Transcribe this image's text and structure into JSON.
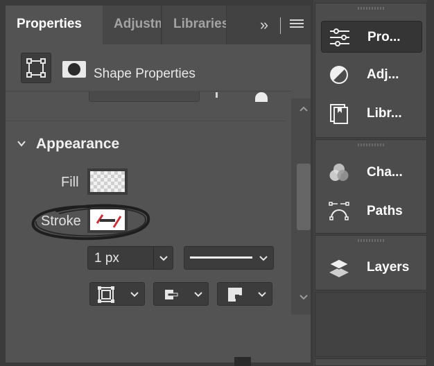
{
  "tabs": [
    {
      "label": "Properties",
      "active": true
    },
    {
      "label": "Adjustm",
      "active": false
    },
    {
      "label": "Libraries",
      "active": false
    }
  ],
  "tab_collapse_label": "»",
  "shape_header": {
    "title": "Shape Properties"
  },
  "appearance": {
    "title": "Appearance",
    "fill_label": "Fill",
    "stroke_label": "Stroke",
    "stroke_width": "1 px"
  },
  "dock": {
    "items": [
      {
        "label": "Pro...",
        "icon": "sliders-icon"
      },
      {
        "label": "Adj...",
        "icon": "adjustments-icon"
      },
      {
        "label": "Libr...",
        "icon": "libraries-icon"
      },
      {
        "label": "Cha...",
        "icon": "channels-icon"
      },
      {
        "label": "Paths",
        "icon": "paths-icon"
      },
      {
        "label": "Layers",
        "icon": "layers-icon"
      }
    ]
  },
  "colors": {
    "panel_bg": "#535353",
    "dock_bg": "#424242",
    "stroke_swatch_accent": "#c8323a"
  }
}
